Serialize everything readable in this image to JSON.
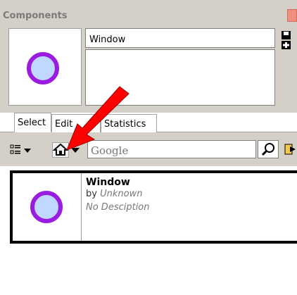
{
  "window": {
    "title": "Components",
    "close_icon": "close-icon"
  },
  "component": {
    "name": "Window",
    "description": ""
  },
  "tabs": [
    {
      "label": "Select",
      "active": true
    },
    {
      "label": "Edit",
      "active": false
    },
    {
      "label": "Statistics",
      "active": false
    }
  ],
  "toolbar": {
    "view_icon": "list-view-icon",
    "home_icon": "home-icon",
    "dropdown_icon": "chevron-down-icon",
    "search_placeholder": "Google",
    "search_icon": "magnifier-icon",
    "navigate_icon": "navigate-icon"
  },
  "results": [
    {
      "name": "Window",
      "by_prefix": "by",
      "author": "Unknown",
      "description": "No Desciption"
    }
  ],
  "colors": {
    "panel_bg": "#d4d0c8",
    "circle_fill": "#c0d8ff",
    "circle_ring": "#9a1ce0",
    "annotation_arrow": "#ff0000"
  }
}
